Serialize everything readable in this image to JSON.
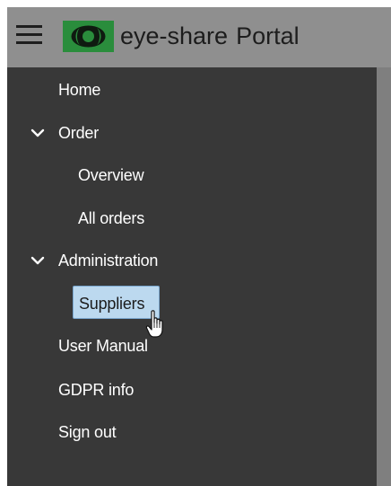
{
  "header": {
    "brand_name": "eye-share",
    "brand_suffix": "Portal",
    "menu_icon": "hamburger-menu-icon",
    "logo_icon": "eye-share-logo",
    "colors": {
      "header_bg": "#8f8f8f",
      "logo_green": "#2a8d3c"
    }
  },
  "sidebar": {
    "colors": {
      "bg": "#383838",
      "text": "#ffffff",
      "selected_bg": "#bcd9ef",
      "selected_border": "#7aa7cf"
    },
    "items": {
      "home": "Home",
      "order": "Order",
      "overview": "Overview",
      "all_orders": "All orders",
      "administration": "Administration",
      "suppliers": "Suppliers",
      "user_manual": "User Manual",
      "gdpr_info": "GDPR info",
      "sign_out": "Sign out"
    },
    "expanded_icon": "chevron-down-icon",
    "selected_item": "Suppliers",
    "pointer_icon": "hand-pointer-cursor-icon"
  }
}
